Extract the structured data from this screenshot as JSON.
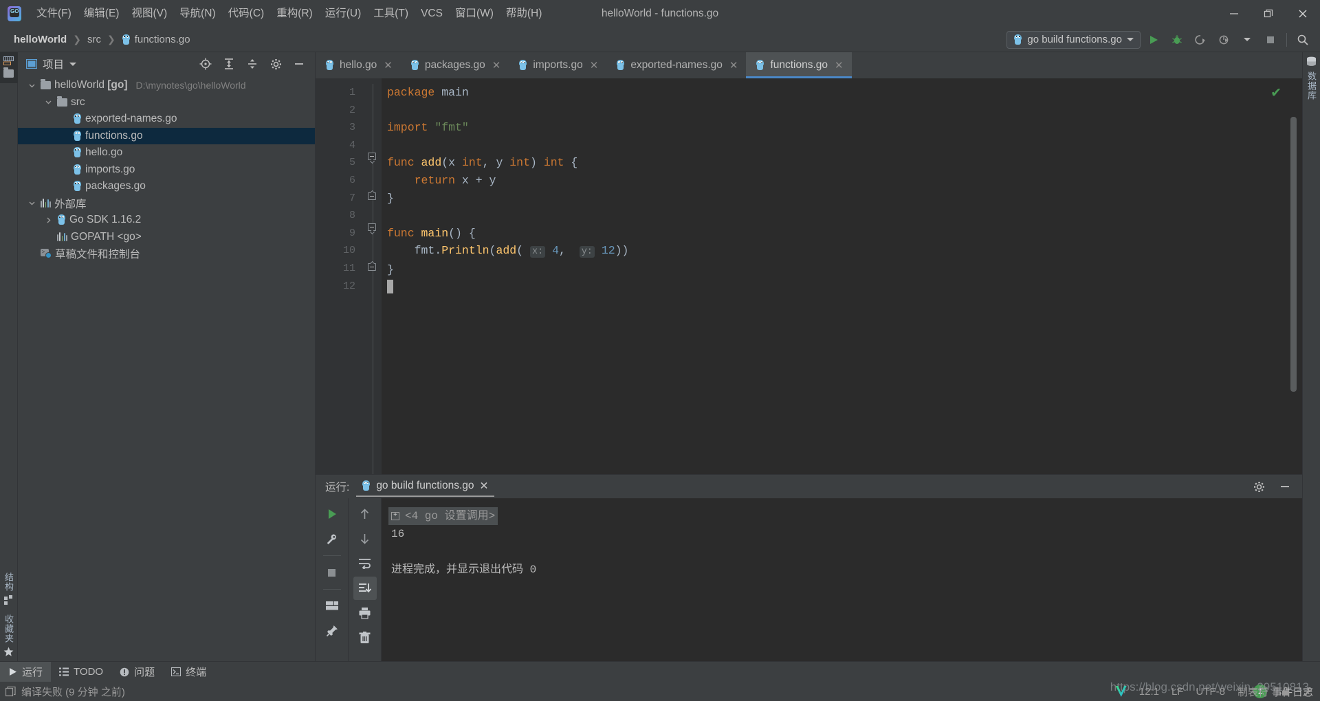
{
  "window": {
    "title": "helloWorld - functions.go",
    "minimize": "—",
    "maximize": "❐",
    "close": "✕"
  },
  "menubar": {
    "items": [
      {
        "label": "文件(F)",
        "name": "menu-file"
      },
      {
        "label": "编辑(E)",
        "name": "menu-edit"
      },
      {
        "label": "视图(V)",
        "name": "menu-view"
      },
      {
        "label": "导航(N)",
        "name": "menu-navigate"
      },
      {
        "label": "代码(C)",
        "name": "menu-code"
      },
      {
        "label": "重构(R)",
        "name": "menu-refactor"
      },
      {
        "label": "运行(U)",
        "name": "menu-run"
      },
      {
        "label": "工具(T)",
        "name": "menu-tools"
      },
      {
        "label": "VCS",
        "name": "menu-vcs"
      },
      {
        "label": "窗口(W)",
        "name": "menu-window"
      },
      {
        "label": "帮助(H)",
        "name": "menu-help"
      }
    ]
  },
  "navbar": {
    "breadcrumbs": [
      {
        "label": "helloWorld",
        "bold": true
      },
      {
        "label": "src",
        "bold": false
      },
      {
        "label": "functions.go",
        "bold": false
      }
    ],
    "separator": "❯",
    "run_config": "go build functions.go"
  },
  "project": {
    "panel_title": "项目",
    "tree": [
      {
        "label": "helloWorld",
        "tag": "[go]",
        "path": "D:\\mynotes\\go\\helloWorld",
        "icon": "folder-icon",
        "indent": 0,
        "chevron": "down",
        "selected": false
      },
      {
        "label": "src",
        "tag": "",
        "path": "",
        "icon": "folder-icon",
        "indent": 1,
        "chevron": "down",
        "selected": false
      },
      {
        "label": "exported-names.go",
        "tag": "",
        "path": "",
        "icon": "go-file-icon",
        "indent": 2,
        "chevron": "none",
        "selected": false
      },
      {
        "label": "functions.go",
        "tag": "",
        "path": "",
        "icon": "go-file-icon",
        "indent": 2,
        "chevron": "none",
        "selected": true
      },
      {
        "label": "hello.go",
        "tag": "",
        "path": "",
        "icon": "go-file-icon",
        "indent": 2,
        "chevron": "none",
        "selected": false
      },
      {
        "label": "imports.go",
        "tag": "",
        "path": "",
        "icon": "go-file-icon",
        "indent": 2,
        "chevron": "none",
        "selected": false
      },
      {
        "label": "packages.go",
        "tag": "",
        "path": "",
        "icon": "go-file-icon",
        "indent": 2,
        "chevron": "none",
        "selected": false
      },
      {
        "label": "外部库",
        "tag": "",
        "path": "",
        "icon": "library-icon",
        "indent": 0,
        "chevron": "down",
        "selected": false
      },
      {
        "label": "Go SDK 1.16.2",
        "tag": "",
        "path": "",
        "icon": "go-file-icon",
        "indent": 1,
        "chevron": "right",
        "selected": false
      },
      {
        "label": "GOPATH <go>",
        "tag": "",
        "path": "",
        "icon": "library-icon",
        "indent": 1,
        "chevron": "none",
        "selected": false
      },
      {
        "label": "草稿文件和控制台",
        "tag": "",
        "path": "",
        "icon": "scratch-icon",
        "indent": 0,
        "chevron": "none",
        "selected": false
      }
    ]
  },
  "stripes": {
    "left_top": [
      "项目"
    ],
    "left_bottom": [
      "结构",
      "收藏夹"
    ],
    "right": [
      "数据库"
    ]
  },
  "editor": {
    "tabs": [
      {
        "label": "hello.go",
        "active": false
      },
      {
        "label": "packages.go",
        "active": false
      },
      {
        "label": "imports.go",
        "active": false
      },
      {
        "label": "exported-names.go",
        "active": false
      },
      {
        "label": "functions.go",
        "active": true
      }
    ],
    "close_glyph": "✕",
    "line_numbers": [
      "1",
      "2",
      "3",
      "4",
      "5",
      "6",
      "7",
      "8",
      "9",
      "10",
      "11",
      "12"
    ],
    "lines": [
      {
        "n": 1,
        "tokens": [
          {
            "t": "package",
            "c": "kw"
          },
          {
            "t": " ",
            "c": "id"
          },
          {
            "t": "main",
            "c": "id"
          }
        ]
      },
      {
        "n": 2,
        "tokens": []
      },
      {
        "n": 3,
        "tokens": [
          {
            "t": "import",
            "c": "kw"
          },
          {
            "t": " ",
            "c": "id"
          },
          {
            "t": "\"fmt\"",
            "c": "str"
          }
        ]
      },
      {
        "n": 4,
        "tokens": []
      },
      {
        "n": 5,
        "tokens": [
          {
            "t": "func",
            "c": "kw"
          },
          {
            "t": " ",
            "c": "id"
          },
          {
            "t": "add",
            "c": "fn"
          },
          {
            "t": "(x ",
            "c": "id"
          },
          {
            "t": "int",
            "c": "kw"
          },
          {
            "t": ", y ",
            "c": "id"
          },
          {
            "t": "int",
            "c": "kw"
          },
          {
            "t": ") ",
            "c": "id"
          },
          {
            "t": "int",
            "c": "kw"
          },
          {
            "t": " {",
            "c": "id"
          }
        ]
      },
      {
        "n": 6,
        "tokens": [
          {
            "t": "    ",
            "c": "id"
          },
          {
            "t": "return",
            "c": "kw"
          },
          {
            "t": " x + y",
            "c": "id"
          }
        ]
      },
      {
        "n": 7,
        "tokens": [
          {
            "t": "}",
            "c": "id"
          }
        ]
      },
      {
        "n": 8,
        "tokens": []
      },
      {
        "n": 9,
        "tokens": [
          {
            "t": "func",
            "c": "kw"
          },
          {
            "t": " ",
            "c": "id"
          },
          {
            "t": "main",
            "c": "fn"
          },
          {
            "t": "() {",
            "c": "id"
          }
        ]
      },
      {
        "n": 10,
        "tokens": [
          {
            "t": "    fmt.",
            "c": "id"
          },
          {
            "t": "Println",
            "c": "fn"
          },
          {
            "t": "(",
            "c": "id"
          },
          {
            "t": "add",
            "c": "fn"
          },
          {
            "t": "( ",
            "c": "id"
          },
          {
            "t": "x:",
            "c": "hint"
          },
          {
            "t": " ",
            "c": "id"
          },
          {
            "t": "4",
            "c": "num"
          },
          {
            "t": ", ",
            "c": "id"
          },
          {
            "t": "y:",
            "c": "hint"
          },
          {
            "t": " ",
            "c": "id"
          },
          {
            "t": "12",
            "c": "num"
          },
          {
            "t": "))",
            "c": "id"
          }
        ]
      },
      {
        "n": 11,
        "tokens": [
          {
            "t": "}",
            "c": "id"
          }
        ]
      },
      {
        "n": 12,
        "tokens": []
      }
    ],
    "run_gutter_line": 9,
    "inspection_status": "✔"
  },
  "run_panel": {
    "label": "运行:",
    "tab_title": "go build functions.go",
    "close_glyph": "✕",
    "console": {
      "command": "<4 go 设置调用>",
      "expand_glyph": "+",
      "output": "16",
      "exit_message": "进程完成，并显示退出代码",
      "exit_code": "0"
    },
    "tools_left": [
      "run-icon",
      "wrench-icon",
      "stop-icon",
      "layout-icon",
      "pin-icon"
    ],
    "tools_right": [
      "scroll-up-icon",
      "scroll-down-icon",
      "soft-wrap-icon",
      "scroll-to-end-icon",
      "print-icon",
      "trash-icon"
    ]
  },
  "bottom_bar": {
    "items": [
      {
        "label": "运行",
        "icon": "play-icon",
        "active": true
      },
      {
        "label": "TODO",
        "icon": "list-icon",
        "active": false
      },
      {
        "label": "问题",
        "icon": "warning-icon",
        "active": false
      },
      {
        "label": "终端",
        "icon": "terminal-icon",
        "active": false
      }
    ]
  },
  "status_bar": {
    "left_text": "编译失败 (9 分钟 之前)",
    "event_log": "事件日志",
    "event_count": "1",
    "caret_position": "12:1",
    "line_separator": "LF",
    "encoding": "UTF-8",
    "indent": "制表符",
    "watermark": "https://blog.csdn.net/weixin_39510813"
  },
  "colors": {
    "accent_blue": "#4a88c7",
    "selection_blue": "#0d293e",
    "green": "#499c54",
    "keyword_orange": "#cc7832",
    "string_green": "#6a8759",
    "function_yellow": "#ffc66d",
    "number_blue": "#6897bb",
    "panel_bg": "#3c3f41",
    "editor_bg": "#2b2b2b"
  }
}
